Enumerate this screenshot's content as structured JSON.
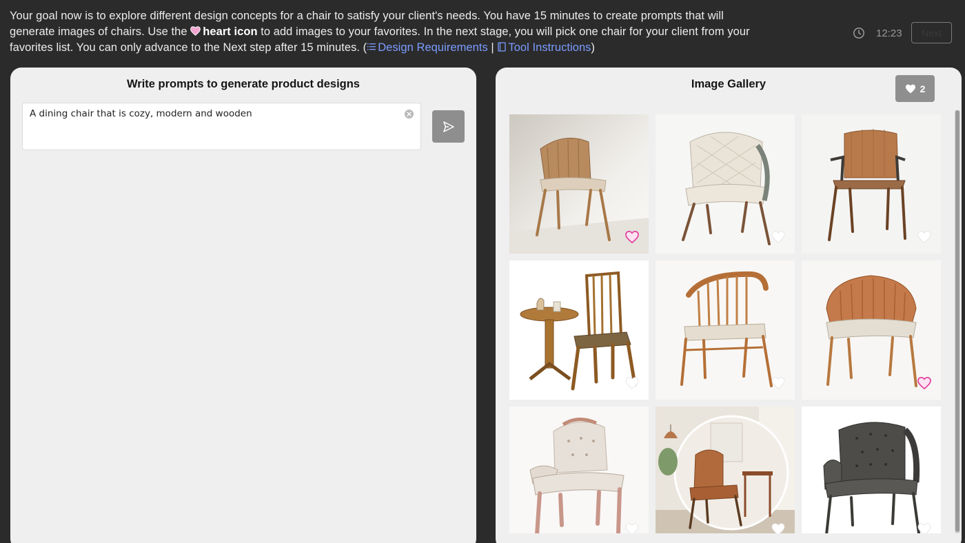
{
  "intro": {
    "part1": "Your goal now is to explore different design concepts for a chair to satisfy your client's needs. You have 15 minutes to create prompts that will generate images of chairs. Use the ",
    "heart_label": "heart icon",
    "part2": " to add images to your favorites. In the next stage, you will pick one chair for your client from your favorites list. You can only advance to the Next step after 15 minutes. (",
    "design_link": "Design Requirements",
    "separator": " | ",
    "tool_link": "Tool Instructions",
    "part3": ")"
  },
  "timer": {
    "time": "12:23"
  },
  "next_button": {
    "label": "Next"
  },
  "prompt_panel": {
    "title": "Write prompts to generate product designs",
    "input_value": "A dining chair that is cozy, modern and wooden"
  },
  "gallery": {
    "title": "Image Gallery",
    "favorites_count": "2",
    "images": [
      {
        "name": "gallery-image-1",
        "favorited": true
      },
      {
        "name": "gallery-image-2",
        "favorited": false
      },
      {
        "name": "gallery-image-3",
        "favorited": false
      },
      {
        "name": "gallery-image-4",
        "favorited": false
      },
      {
        "name": "gallery-image-5",
        "favorited": false
      },
      {
        "name": "gallery-image-6",
        "favorited": true
      },
      {
        "name": "gallery-image-7",
        "favorited": false
      },
      {
        "name": "gallery-image-8",
        "favorited": false
      },
      {
        "name": "gallery-image-9",
        "favorited": false
      }
    ]
  },
  "colors": {
    "background": "#2b2b2b",
    "panel": "#efefef",
    "link": "#7b9cff",
    "heart_favorited": "#e0399b",
    "heart_unfavorited": "#ffffff",
    "badge": "#8f8f8f"
  },
  "icons": {
    "heart": "heart-icon",
    "list": "list-icon",
    "book": "book-icon",
    "clock": "clock-icon",
    "send": "send-icon",
    "clear": "clear-icon"
  }
}
